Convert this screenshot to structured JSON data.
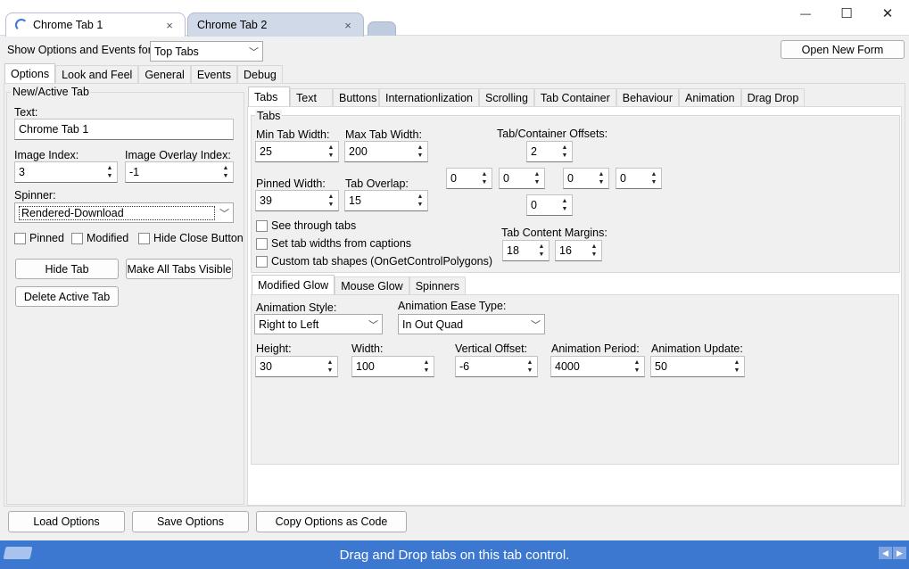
{
  "window": {
    "tabs": [
      {
        "label": "Chrome Tab 1"
      },
      {
        "label": "Chrome Tab 2"
      }
    ],
    "close_glyph": "×",
    "min_glyph": "—",
    "max_glyph": "☐",
    "closewin_glyph": "✕"
  },
  "top": {
    "show_label": "Show Options and Events for:",
    "show_value": "Top Tabs",
    "open_form": "Open New Form"
  },
  "left_tabs": [
    "Options",
    "Look and Feel",
    "General",
    "Events",
    "Debug"
  ],
  "newtab": {
    "group": "New/Active Tab",
    "text_label": "Text:",
    "text_value": "Chrome Tab 1",
    "image_index_label": "Image Index:",
    "image_index_value": "3",
    "overlay_label": "Image Overlay Index:",
    "overlay_value": "-1",
    "spinner_label": "Spinner:",
    "spinner_value": "Rendered-Download",
    "pinned": "Pinned",
    "modified": "Modified",
    "hide_close": "Hide Close Button",
    "hide_tab": "Hide Tab",
    "make_visible": "Make All Tabs Visible",
    "delete_tab": "Delete Active Tab"
  },
  "right_tabs": [
    "Tabs",
    "Text",
    "Buttons",
    "Internationlization",
    "Scrolling",
    "Tab Container",
    "Behaviour",
    "Animation",
    "Drag Drop"
  ],
  "tabs_group": {
    "title": "Tabs",
    "min_w_label": "Min Tab Width:",
    "min_w": "25",
    "max_w_label": "Max Tab Width:",
    "max_w": "200",
    "pinned_w_label": "Pinned Width:",
    "pinned_w": "39",
    "overlap_label": "Tab Overlap:",
    "overlap": "15",
    "see_through": "See through tabs",
    "widths_captions": "Set tab widths from captions",
    "custom_shapes": "Custom tab shapes (OnGetControlPolygons)",
    "offsets_label": "Tab/Container Offsets:",
    "off_top": "2",
    "off_l1": "0",
    "off_l2": "0",
    "off_r1": "0",
    "off_r2": "0",
    "off_bottom": "0",
    "margins_label": "Tab Content Margins:",
    "margin1": "18",
    "margin2": "16"
  },
  "glow_tabs": [
    "Modified Glow",
    "Mouse Glow",
    "Spinners"
  ],
  "glow": {
    "anim_style_label": "Animation Style:",
    "anim_style": "Right to Left",
    "ease_label": "Animation Ease Type:",
    "ease": "In Out Quad",
    "height_label": "Height:",
    "height": "30",
    "width_label": "Width:",
    "width": "100",
    "voff_label": "Vertical Offset:",
    "voff": "-6",
    "period_label": "Animation Period:",
    "period": "4000",
    "update_label": "Animation Update:",
    "update": "50"
  },
  "bottom": {
    "load": "Load Options",
    "save": "Save Options",
    "copy": "Copy Options as Code"
  },
  "status": {
    "text": "Drag and Drop tabs on this tab control.",
    "accent": "#3c78d0"
  }
}
